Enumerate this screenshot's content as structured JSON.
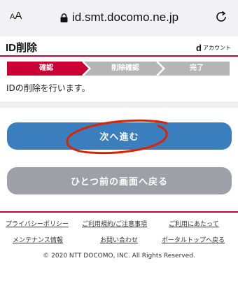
{
  "browser": {
    "text_size_label_small": "A",
    "text_size_label_large": "A",
    "url": "id.smt.docomo.ne.jp"
  },
  "header": {
    "title": "ID削除",
    "account_logo_letter": "d",
    "account_logo_text": "アカウント"
  },
  "steps": [
    {
      "label": "確認",
      "active": true
    },
    {
      "label": "削除確認",
      "active": false
    },
    {
      "label": "完了",
      "active": false
    }
  ],
  "colors": {
    "active_step": "#cc0033",
    "inactive_step": "#b5b5b5",
    "primary_button": "#3a7ebd",
    "secondary_button": "#9da0a6",
    "annotation": "#dd2200"
  },
  "description": "IDの削除を行います。",
  "buttons": {
    "next": "次へ進む",
    "back": "ひとつ前の画面へ戻る"
  },
  "footer": {
    "links_row1": [
      "プライバシーポリシー",
      "ご利用規約/ご注意事項",
      "ご利用にあたって"
    ],
    "links_row2": [
      "メンテナンス情報",
      "お問い合わせ",
      "ポータルトップへ戻る"
    ],
    "copyright": "© 2020 NTT DOCOMO, INC. All Rights Reserved."
  }
}
